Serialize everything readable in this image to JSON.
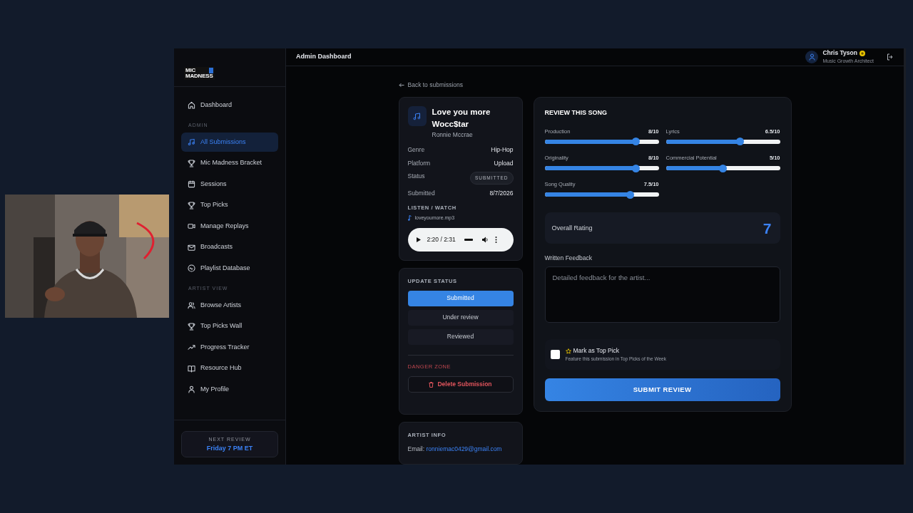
{
  "sidebar": {
    "logo": {
      "line1": "MIC",
      "line2": "MADNESS"
    },
    "sections": [
      {
        "items": [
          {
            "label": "Dashboard",
            "selected": false
          }
        ]
      },
      {
        "title": "ADMIN",
        "items": [
          {
            "label": "All Submissions",
            "selected": true
          },
          {
            "label": "Mic Madness Bracket",
            "selected": false
          },
          {
            "label": "Sessions",
            "selected": false
          },
          {
            "label": "Top Picks",
            "selected": false
          },
          {
            "label": "Manage Replays",
            "selected": false
          },
          {
            "label": "Broadcasts",
            "selected": false
          },
          {
            "label": "Playlist Database",
            "selected": false
          }
        ]
      },
      {
        "title": "ARTIST VIEW",
        "items": [
          {
            "label": "Browse Artists",
            "selected": false
          },
          {
            "label": "Top Picks Wall",
            "selected": false
          },
          {
            "label": "Progress Tracker",
            "selected": false
          },
          {
            "label": "Resource Hub",
            "selected": false
          },
          {
            "label": "My Profile",
            "selected": false
          }
        ]
      }
    ],
    "next_review": {
      "label": "NEXT REVIEW",
      "value": "Friday 7 PM ET"
    }
  },
  "header": {
    "title": "Admin Dashboard",
    "user": {
      "name": "Chris Tyson",
      "role": "Music Growth Architect"
    }
  },
  "back_link": "Back to submissions",
  "song": {
    "title": "Love you more Wocc$tar",
    "artist": "Ronnie Mccrae",
    "details": [
      {
        "label": "Genre",
        "value": "Hip-Hop",
        "kind": "text"
      },
      {
        "label": "Platform",
        "value": "Upload",
        "kind": "text"
      },
      {
        "label": "Status",
        "value": "SUBMITTED",
        "kind": "badge"
      },
      {
        "label": "Submitted",
        "value": "8/7/2026",
        "kind": "text"
      }
    ],
    "listen_title": "LISTEN / WATCH",
    "file": "loveyoumore.mp3",
    "player": {
      "time": "2:20 / 2:31"
    }
  },
  "update_status": {
    "title": "UPDATE STATUS",
    "options": [
      {
        "label": "Submitted",
        "selected": true
      },
      {
        "label": "Under review",
        "selected": false
      },
      {
        "label": "Reviewed",
        "selected": false
      }
    ],
    "danger_title": "DANGER ZONE",
    "delete_label": "Delete Submission"
  },
  "artist_info": {
    "title": "ARTIST INFO",
    "email_label": "Email:",
    "email": "ronniemac0429@gmail.com"
  },
  "review": {
    "title": "REVIEW THIS SONG",
    "ratings": [
      {
        "label": "Production",
        "reading": "8/10",
        "level": 0.8
      },
      {
        "label": "Lyrics",
        "reading": "6.5/10",
        "level": 0.65
      },
      {
        "label": "Originality",
        "reading": "8/10",
        "level": 0.8
      },
      {
        "label": "Commercial Potential",
        "reading": "5/10",
        "level": 0.5
      },
      {
        "label": "Song Quality",
        "reading": "7.5/10",
        "level": 0.75
      }
    ],
    "overall": {
      "label": "Overall Rating",
      "value": "7"
    },
    "feedback": {
      "label": "Written Feedback",
      "placeholder": "Detailed feedback for the artist..."
    },
    "top_pick": {
      "label": "Mark as Top Pick",
      "hint": "Feature this submission in Top Picks of the Week",
      "checked": false
    },
    "submit": "SUBMIT REVIEW"
  }
}
